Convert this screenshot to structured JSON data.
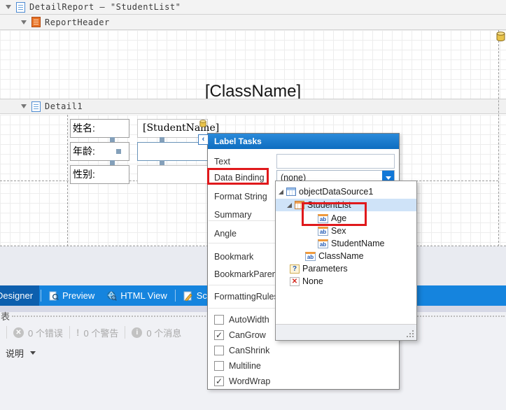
{
  "bands": {
    "detail_report": "DetailReport — \"StudentList\"",
    "report_header": "ReportHeader",
    "detail": "Detail1"
  },
  "report": {
    "class_name": "[ClassName]",
    "rows": [
      {
        "label": "姓名:",
        "value": "[StudentName]"
      },
      {
        "label": "年龄:",
        "value": ""
      },
      {
        "label": "性别:",
        "value": ""
      }
    ]
  },
  "smart_tag": "‹",
  "label_tasks": {
    "title": "Label Tasks",
    "text_label": "Text",
    "text_value": "",
    "data_binding_label": "Data Binding",
    "data_binding_value": "(none)",
    "links": [
      "Format String",
      "Summary",
      "Angle",
      "Bookmark",
      "BookmarkParent",
      "FormattingRules"
    ],
    "checkboxes": [
      {
        "label": "AutoWidth",
        "checked": false
      },
      {
        "label": "CanGrow",
        "checked": true
      },
      {
        "label": "CanShrink",
        "checked": false
      },
      {
        "label": "Multiline",
        "checked": false
      },
      {
        "label": "WordWrap",
        "checked": true
      }
    ]
  },
  "binding_tree": {
    "datasource": "objectDataSource1",
    "list": "StudentList",
    "list_fields": [
      "Age",
      "Sex",
      "StudentName"
    ],
    "root_field": "ClassName",
    "parameters": "Parameters",
    "none": "None"
  },
  "tabs": [
    "Designer",
    "Preview",
    "HTML View",
    "Scripts"
  ],
  "statusbar": {
    "list_label": "表",
    "errors": "0 个错误",
    "warnings": "0 个警告",
    "messages": "0 个消息",
    "description": "说明"
  },
  "colors": {
    "tabbar_blue": "#1584de",
    "selected_tab_blue": "#0d5fae",
    "tasks_header_blue": "#0e6dc0",
    "combo_button_blue": "#1177d7",
    "highlight_red": "#e0191c",
    "tree_selection_blue": "#cfe3f8"
  }
}
